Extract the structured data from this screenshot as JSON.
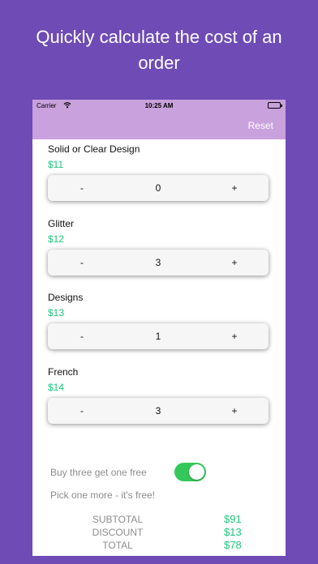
{
  "promo": {
    "headline": "Quickly calculate the cost of an order"
  },
  "status_bar": {
    "carrier": "Carrier",
    "time": "10:25 AM"
  },
  "nav": {
    "reset_label": "Reset"
  },
  "items": [
    {
      "name": "Solid or Clear Design",
      "price": "$11",
      "quantity": "0",
      "minus": "-",
      "plus": "+"
    },
    {
      "name": "Glitter",
      "price": "$12",
      "quantity": "3",
      "minus": "-",
      "plus": "+"
    },
    {
      "name": "Designs",
      "price": "$13",
      "quantity": "1",
      "minus": "-",
      "plus": "+"
    },
    {
      "name": "French",
      "price": "$14",
      "quantity": "3",
      "minus": "-",
      "plus": "+"
    }
  ],
  "promotion": {
    "label": "Buy three get one free",
    "enabled": true,
    "note": "Pick one more - it's free!"
  },
  "totals": {
    "subtotal_label": "SUBTOTAL",
    "subtotal": "$91",
    "discount_label": "DISCOUNT",
    "discount": "$13",
    "total_label": "TOTAL",
    "total": "$78"
  },
  "colors": {
    "background": "#6f4bb6",
    "nav_bar": "#c9a1dc",
    "price_green": "#1cc67a",
    "toggle_on": "#34c759"
  }
}
